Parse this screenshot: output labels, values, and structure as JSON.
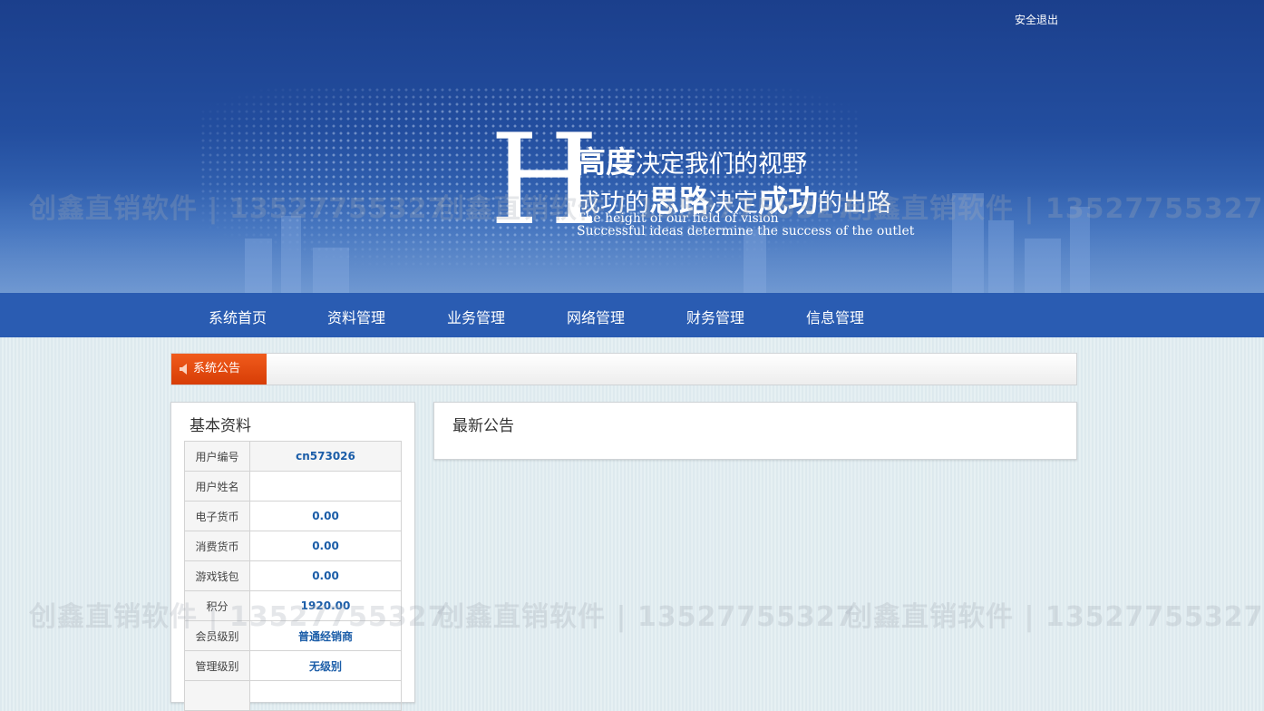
{
  "header": {
    "logout_label": "安全退出",
    "slogan": {
      "big_letter": "H",
      "line1_bold": "高度",
      "line1_rest": "决定我们的视野",
      "line2_a": "成功的",
      "line2_b": "思路",
      "line2_c": "决定",
      "line2_d": "成功",
      "line2_e": "的出路",
      "english_1": "The height of our field of vision",
      "english_2": "Successful ideas determine the success of the outlet"
    }
  },
  "nav": {
    "items": [
      {
        "label": "系统首页"
      },
      {
        "label": "资料管理"
      },
      {
        "label": "业务管理"
      },
      {
        "label": "网络管理"
      },
      {
        "label": "财务管理"
      },
      {
        "label": "信息管理"
      }
    ]
  },
  "notice": {
    "tab_label": "系统公告",
    "icon": "speaker-icon"
  },
  "profile": {
    "title": "基本资料",
    "rows": [
      {
        "label": "用户编号",
        "value": "cn573026"
      },
      {
        "label": "用户姓名",
        "value": ""
      },
      {
        "label": "电子货币",
        "value": "0.00"
      },
      {
        "label": "消费货币",
        "value": "0.00"
      },
      {
        "label": "游戏钱包",
        "value": "0.00"
      },
      {
        "label": "积分",
        "value": "1920.00"
      },
      {
        "label": "会员级别",
        "value": "普通经销商"
      },
      {
        "label": "管理级别",
        "value": "无级别"
      },
      {
        "label": "",
        "value": ""
      }
    ]
  },
  "announcements": {
    "title": "最新公告"
  },
  "watermark": {
    "text": "创鑫直销软件 | 13527755327"
  },
  "colors": {
    "nav_bg": "#2a5cb2",
    "notice_tab": "#e84c10",
    "value_text": "#1b5da8",
    "banner_top": "#1b3f8c"
  }
}
